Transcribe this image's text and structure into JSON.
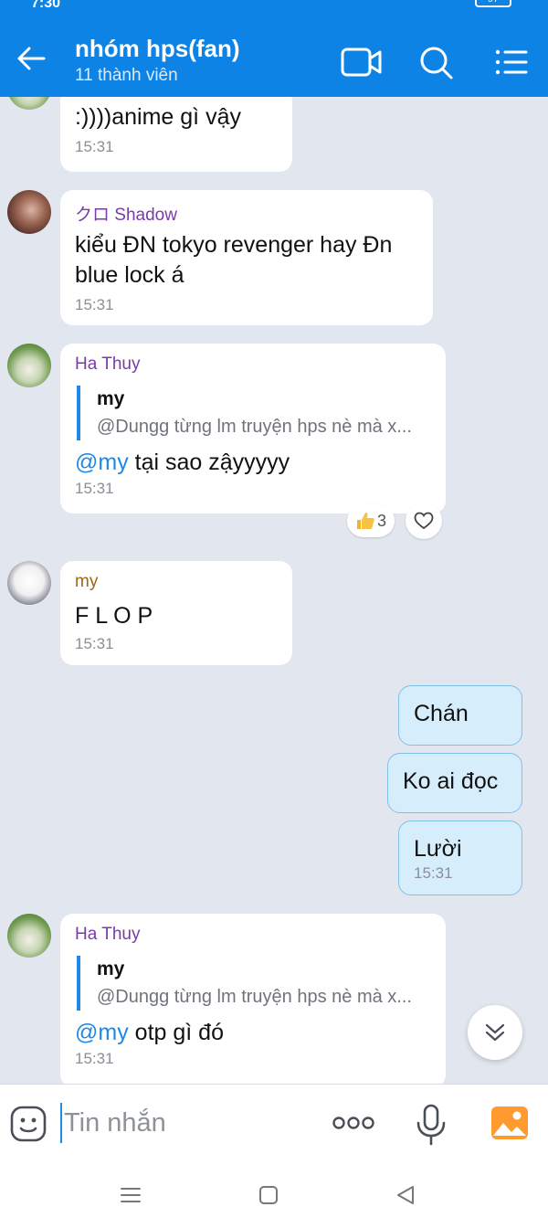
{
  "status_bar": {
    "time": "7:30",
    "battery": "97"
  },
  "header": {
    "title": "nhóm hps(fan)",
    "subtitle": "11 thành viên"
  },
  "messages": [
    {
      "type": "incoming",
      "sender": "",
      "text": ":))))anime gì vậy",
      "time": "15:31"
    },
    {
      "type": "incoming",
      "sender": "クロ Shadow",
      "text_lines": [
        "kiểu ĐN tokyo revenger hay Đn",
        "blue lock á"
      ],
      "time": "15:31"
    },
    {
      "type": "incoming",
      "sender": "Ha Thuy",
      "quote": {
        "name": "my",
        "text": "@Dungg từng lm truyện hps nè mà x..."
      },
      "mention": "@my",
      "text": " tại sao zậyyyyy",
      "time": "15:31",
      "reaction": {
        "count": "3"
      }
    },
    {
      "type": "incoming",
      "sender": "my",
      "text": "F L O P",
      "time": "15:31"
    },
    {
      "type": "outgoing",
      "text": "Chán"
    },
    {
      "type": "outgoing",
      "text": "Ko ai đọc"
    },
    {
      "type": "outgoing",
      "text": "Lười",
      "time": "15:31"
    },
    {
      "type": "incoming",
      "sender": "Ha Thuy",
      "quote": {
        "name": "my",
        "text": "@Dungg từng lm truyện hps nè mà x..."
      },
      "mention": "@my",
      "text": " otp gì đó",
      "time": "15:31"
    }
  ],
  "input": {
    "placeholder": "Tin nhắn"
  },
  "colors": {
    "header": "#0d84e5",
    "mention": "#1d8ae8",
    "outgoing_bubble": "#d6eefc",
    "background": "#e2e6ee"
  }
}
